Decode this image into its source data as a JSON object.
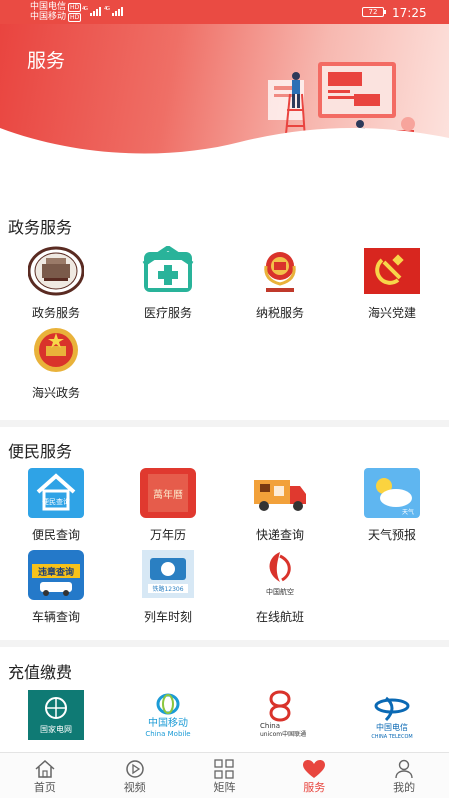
{
  "status_bar": {
    "carrier1": "中国电信",
    "carrier2": "中国移动",
    "hd_badge": "HD",
    "network1": "4G",
    "network2": "4G",
    "battery": "72",
    "time": "17:25"
  },
  "header": {
    "title": "服务"
  },
  "sections": [
    {
      "title": "政务服务",
      "items": [
        {
          "label": "政务服务",
          "icon": "government-building-icon"
        },
        {
          "label": "医疗服务",
          "icon": "medical-icon"
        },
        {
          "label": "纳税服务",
          "icon": "tax-emblem-icon"
        },
        {
          "label": "海兴党建",
          "icon": "party-flag-icon"
        },
        {
          "label": "海兴政务",
          "icon": "national-emblem-icon"
        }
      ]
    },
    {
      "title": "便民服务",
      "items": [
        {
          "label": "便民查询",
          "icon": "convenience-house-icon",
          "icon_text": "便民查询"
        },
        {
          "label": "万年历",
          "icon": "calendar-icon",
          "icon_text": "萬年曆"
        },
        {
          "label": "快递查询",
          "icon": "delivery-truck-icon"
        },
        {
          "label": "天气预报",
          "icon": "weather-icon",
          "icon_text": "天气"
        },
        {
          "label": "车辆查询",
          "icon": "vehicle-violation-icon",
          "icon_text": "违章查询"
        },
        {
          "label": "列车时刻",
          "icon": "train-icon",
          "icon_text": "铁路12306"
        },
        {
          "label": "在线航班",
          "icon": "airline-icon",
          "icon_text": "中国航空"
        }
      ]
    },
    {
      "title": "充值缴费",
      "items": [
        {
          "label": "",
          "icon": "state-grid-icon",
          "icon_text": "国家电网"
        },
        {
          "label": "",
          "icon": "china-mobile-icon",
          "icon_text": "中国移动",
          "icon_text2": "China Mobile"
        },
        {
          "label": "",
          "icon": "china-unicom-icon",
          "icon_text": "China",
          "icon_text2": "unicom中国联通"
        },
        {
          "label": "",
          "icon": "china-telecom-icon",
          "icon_text": "中国电信",
          "icon_text2": "CHINA TELECOM"
        }
      ]
    }
  ],
  "bottom_nav": [
    {
      "label": "首页",
      "icon": "home-icon",
      "active": false
    },
    {
      "label": "视频",
      "icon": "video-play-icon",
      "active": false
    },
    {
      "label": "矩阵",
      "icon": "matrix-grid-icon",
      "active": false
    },
    {
      "label": "服务",
      "icon": "heart-icon",
      "active": true
    },
    {
      "label": "我的",
      "icon": "profile-icon",
      "active": false
    }
  ],
  "colors": {
    "accent": "#e8463f",
    "header_red": "#ea4b43"
  }
}
